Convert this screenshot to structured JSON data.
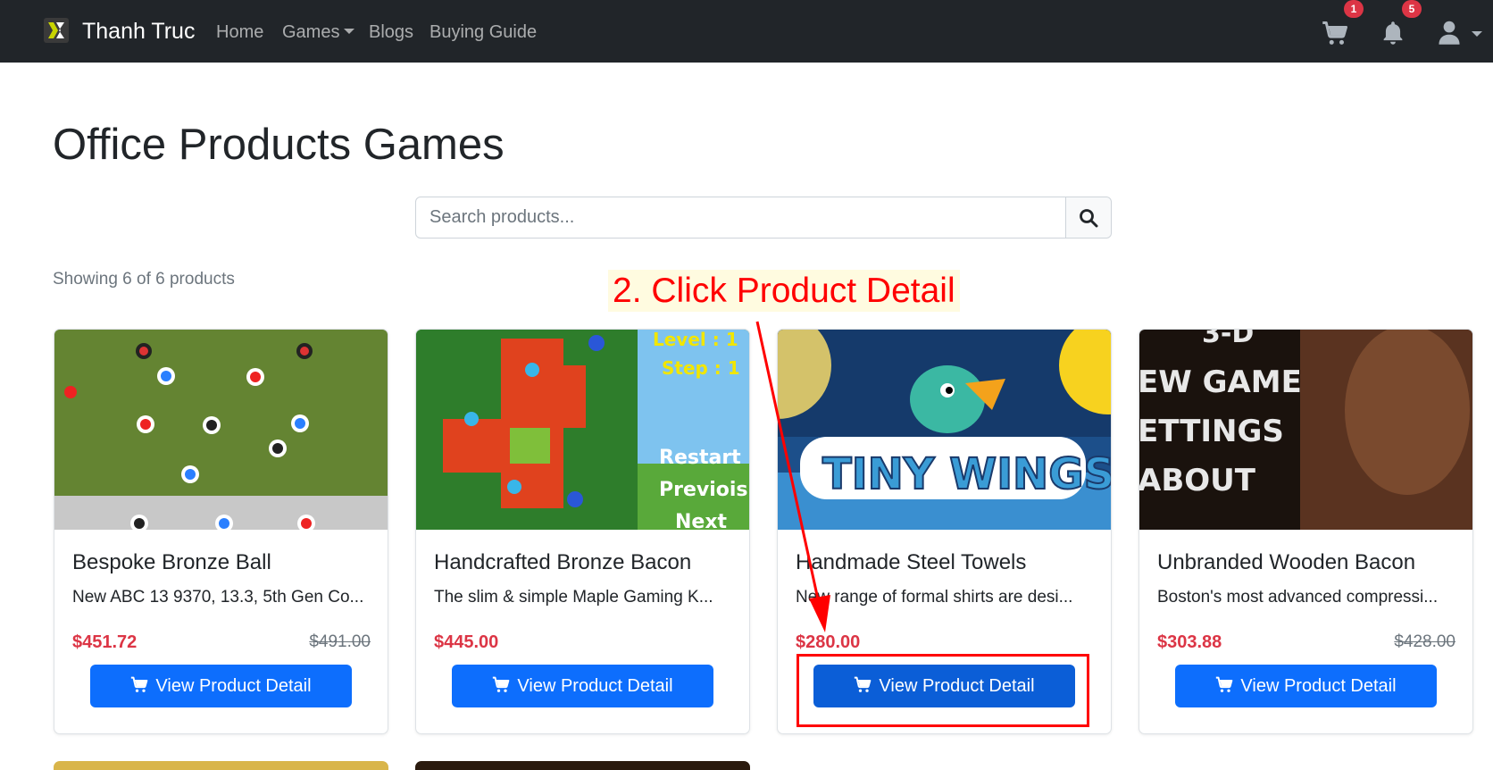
{
  "navbar": {
    "brand": "Thanh Truc",
    "links": [
      "Home",
      "Games",
      "Blogs",
      "Buying Guide"
    ],
    "cart_count": "1",
    "notification_count": "5"
  },
  "page": {
    "title": "Office Products Games",
    "search_placeholder": "Search products...",
    "showing_text": "Showing 6 of 6 products"
  },
  "products": [
    {
      "title": "Bespoke Bronze Ball",
      "description": "New ABC 13 9370, 13.3, 5th Gen Co...",
      "price": "$451.72",
      "old_price": "$491.00",
      "button": "View Product Detail"
    },
    {
      "title": "Handcrafted Bronze Bacon",
      "description": "The slim & simple Maple Gaming K...",
      "price": "$445.00",
      "old_price": "",
      "button": "View Product Detail"
    },
    {
      "title": "Handmade Steel Towels",
      "description": "New range of formal shirts are desi...",
      "price": "$280.00",
      "old_price": "",
      "button": "View Product Detail"
    },
    {
      "title": "Unbranded Wooden Bacon",
      "description": "Boston's most advanced compressi...",
      "price": "$303.88",
      "old_price": "$428.00",
      "button": "View Product Detail"
    }
  ],
  "annotation": {
    "label": "2. Click Product Detail"
  },
  "colors": {
    "navbar": "#212529",
    "primary": "#0d6efd",
    "price": "#dc3545",
    "annotation": "#ff0000"
  }
}
